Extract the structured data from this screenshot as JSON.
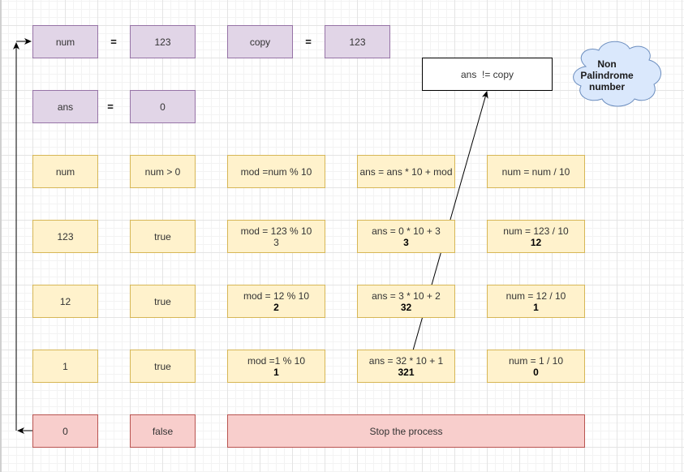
{
  "variables": {
    "num": {
      "label": "num",
      "equals": "=",
      "value": "123"
    },
    "copy": {
      "label": "copy",
      "equals": "=",
      "value": "123"
    },
    "ans": {
      "label": "ans",
      "equals": "=",
      "value": "0"
    }
  },
  "condition_box": {
    "text": "ans  != copy"
  },
  "result_cloud": {
    "line1": "Non Palindrome",
    "line2": "number"
  },
  "table": {
    "header": [
      "num",
      "num > 0",
      "mod =num % 10",
      "ans = ans * 10 + mod",
      "num = num / 10"
    ],
    "rows": [
      {
        "num": "123",
        "cond": "true",
        "mod_expr": "mod = 123 % 10",
        "mod_val": "3",
        "ans_expr": "ans = 0 * 10 + 3",
        "ans_val": "3",
        "div_expr": "num = 123 / 10",
        "div_val": "12"
      },
      {
        "num": "12",
        "cond": "true",
        "mod_expr": "mod = 12 % 10",
        "mod_val": "2",
        "ans_expr": "ans = 3 * 10 + 2",
        "ans_val": "32",
        "div_expr": "num = 12 / 10",
        "div_val": "1"
      },
      {
        "num": "1",
        "cond": "true",
        "mod_expr": "mod =1 % 10",
        "mod_val": "1",
        "ans_expr": "ans = 32 * 10 + 1",
        "ans_val": "321",
        "div_expr": "num = 1 / 10",
        "div_val": "0"
      }
    ],
    "final_row": {
      "num": "0",
      "cond": "false",
      "action": "Stop the process"
    }
  },
  "colors": {
    "variable_fill": "#e1d5e7",
    "variable_stroke": "#9673a6",
    "step_fill": "#fff2cc",
    "step_stroke": "#d6b656",
    "stop_fill": "#f8cecc",
    "stop_stroke": "#b85450",
    "cloud_fill": "#dae8fc",
    "cloud_stroke": "#6c8ebf"
  }
}
